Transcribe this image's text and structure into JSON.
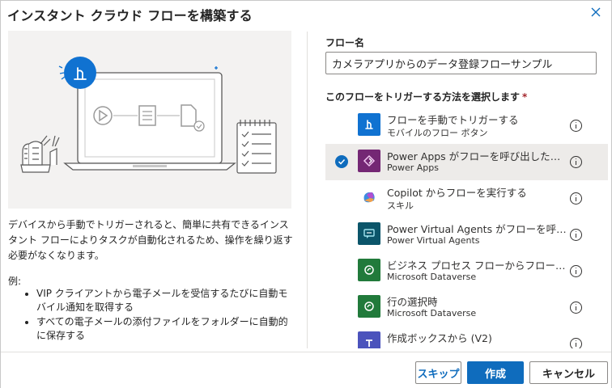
{
  "dialog": {
    "title": "インスタント クラウド フローを構築する",
    "close_icon": "close-icon"
  },
  "left": {
    "description": "デバイスから手動でトリガーされると、簡単に共有できるインスタント フローによりタスクが自動化されるため、操作を繰り返す必要がなくなります。",
    "example_heading": "例:",
    "examples": [
      "VIP クライアントから電子メールを受信するたびに自動モバイル通知を取得する",
      "すべての電子メールの添付ファイルをフォルダーに自動的に保存する"
    ]
  },
  "form": {
    "flow_name_label": "フロー名",
    "flow_name_value": "カメラアプリからのデータ登録フローサンプル",
    "trigger_label": "このフローをトリガーする方法を選択します",
    "required_mark": "*"
  },
  "triggers": [
    {
      "title": "フローを手動でトリガーする",
      "subtitle": "モバイルのフロー ボタン",
      "icon": "touch-icon",
      "color": "#1072d1",
      "selected": false
    },
    {
      "title": "Power Apps がフローを呼び出したとき",
      "subtitle": "Power Apps",
      "icon": "power-apps-icon",
      "color": "#742774",
      "selected": true
    },
    {
      "title": "Copilot からフローを実行する",
      "subtitle": "スキル",
      "icon": "copilot-icon",
      "color": "#ffffff",
      "selected": false
    },
    {
      "title": "Power Virtual Agents がフローを呼び出したとき",
      "subtitle": "Power Virtual Agents",
      "icon": "power-virtual-agents-icon",
      "color": "#0b556a",
      "selected": false
    },
    {
      "title": "ビジネス プロセス フローからフローを実行する",
      "subtitle": "Microsoft Dataverse",
      "icon": "dataverse-icon",
      "color": "#217a3b",
      "selected": false
    },
    {
      "title": "行の選択時",
      "subtitle": "Microsoft Dataverse",
      "icon": "dataverse-icon",
      "color": "#217a3b",
      "selected": false
    },
    {
      "title": "作成ボックスから (V2)",
      "subtitle": "",
      "icon": "teams-icon",
      "color": "#4b53bc",
      "selected": false
    }
  ],
  "footer": {
    "skip_label": "スキップ",
    "create_label": "作成",
    "cancel_label": "キャンセル"
  }
}
